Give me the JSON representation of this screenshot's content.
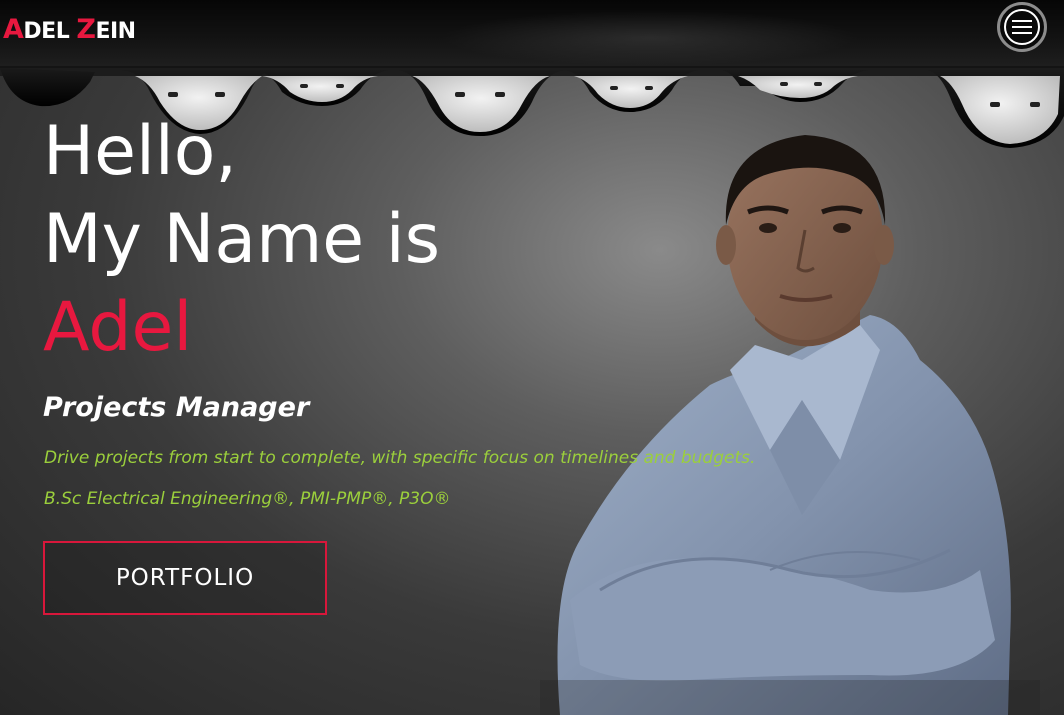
{
  "navbar": {
    "logo": {
      "first_initial": "A",
      "first_rest": "DEL ",
      "last_initial": "Z",
      "last_rest": "EIN"
    },
    "menu_icon": "hamburger-menu-icon"
  },
  "hero": {
    "line1": "Hello,",
    "line2": "My Name is",
    "name": "Adel",
    "role": "Projects Manager",
    "description": "Drive projects from start to complete, with specific focus on timelines and budgets.",
    "credentials": "B.Sc Electrical Engineering®, PMI-PMP®, P3O®",
    "portfolio_label": "PORTFOLIO"
  },
  "colors": {
    "accent": "#e8183f",
    "description_text": "#9bcf3c",
    "navbar_bg": "#0a0a0a"
  }
}
